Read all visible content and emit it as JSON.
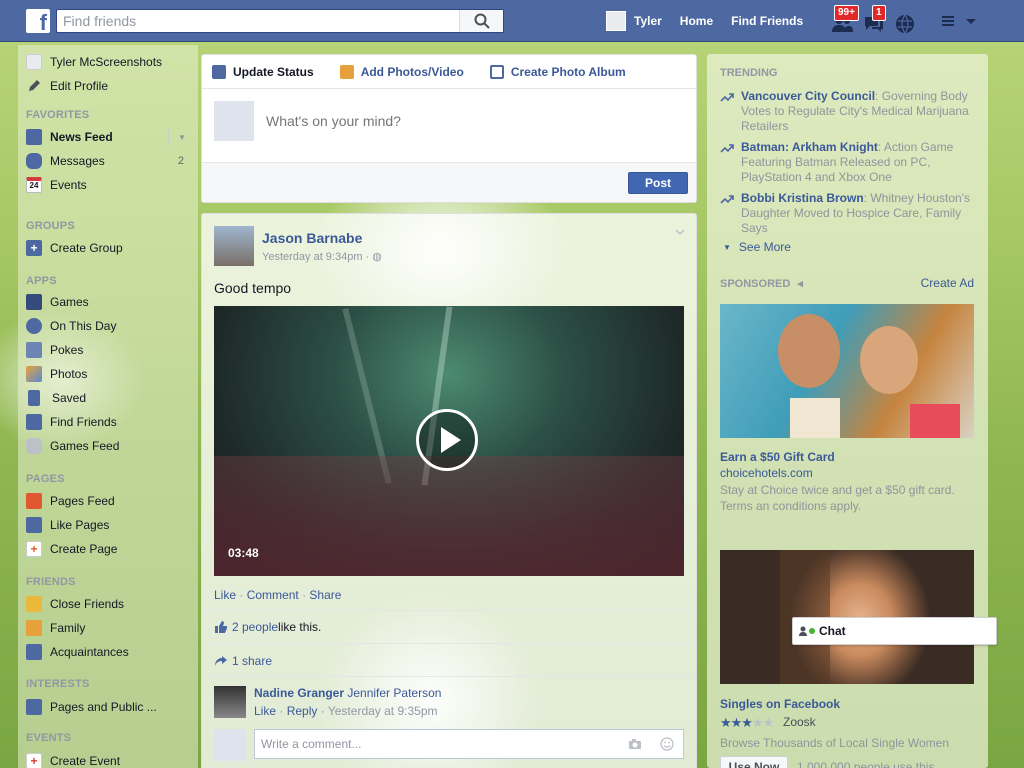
{
  "topbar": {
    "logo": "f",
    "search_placeholder": "Find friends",
    "user_name": "Tyler",
    "nav_home": "Home",
    "nav_find_friends": "Find Friends",
    "friend_requests_badge": "99+",
    "messages_badge": "1"
  },
  "leftnav": {
    "profile_name": "Tyler McScreenshots",
    "edit_profile": "Edit Profile",
    "favorites_head": "FAVORITES",
    "news_feed": "News Feed",
    "messages": "Messages",
    "messages_count": "2",
    "events": "Events",
    "events_icon_text": "24",
    "groups_head": "GROUPS",
    "create_group": "Create Group",
    "apps_head": "APPS",
    "games": "Games",
    "on_this_day": "On This Day",
    "pokes": "Pokes",
    "photos": "Photos",
    "saved": "Saved",
    "find_friends": "Find Friends",
    "games_feed": "Games Feed",
    "pages_head": "PAGES",
    "pages_feed": "Pages Feed",
    "like_pages": "Like Pages",
    "create_page": "Create Page",
    "friends_head": "FRIENDS",
    "close_friends": "Close Friends",
    "family": "Family",
    "acquaintances": "Acquaintances",
    "interests_head": "INTERESTS",
    "pages_public": "Pages and Public ...",
    "events_head": "EVENTS",
    "create_event": "Create Event"
  },
  "composer": {
    "tab_update_status": "Update Status",
    "tab_add_photos": "Add Photos/Video",
    "tab_create_album": "Create Photo Album",
    "placeholder": "What's on your mind?",
    "post_label": "Post"
  },
  "story": {
    "author": "Jason Barnabe",
    "time": "Yesterday at 9:34pm · ",
    "text": "Good tempo",
    "video_duration": "03:48",
    "like": "Like",
    "comment": "Comment",
    "share": "Share",
    "likes_count": "2 people",
    "likes_suffix": " like this.",
    "shares": "1 share",
    "comment_author": "Nadine Granger",
    "comment_text": " Jennifer Paterson",
    "comment_like": "Like",
    "comment_reply": "Reply",
    "comment_time": "Yesterday at 9:35pm",
    "reply_placeholder": "Write a comment..."
  },
  "rightcol": {
    "trending_head": "TRENDING",
    "trends": [
      {
        "title": "Vancouver City Council",
        "desc": ": Governing Body Votes to Regulate City's Medical Marijuana Retailers"
      },
      {
        "title": "Batman: Arkham Knight",
        "desc": ": Action Game Featuring Batman Released on PC, PlayStation 4 and Xbox One"
      },
      {
        "title": "Bobbi Kristina Brown",
        "desc": ": Whitney Houston's Daughter Moved to Hospice Care, Family Says"
      }
    ],
    "see_more": "See More",
    "sponsored_head": "SPONSORED",
    "create_ad": "Create Ad",
    "ad1_title": "Earn a $50 Gift Card",
    "ad1_url": "choicehotels.com",
    "ad1_desc": "Stay at Choice twice and get a $50 gift card. Terms an conditions apply.",
    "ad2_title": "Singles on Facebook",
    "ad2_rating": 3.5,
    "ad2_brand": "Zoosk",
    "ad2_desc": "Browse Thousands of Local Single Women",
    "use_now": "Use Now",
    "ad2_fine": "1,000,000 people use this"
  },
  "chat": {
    "label": "Chat"
  },
  "colors": {
    "brand": "#4e69a2",
    "link": "#3b5998",
    "badge": "#e02828",
    "online": "#42b72a"
  }
}
